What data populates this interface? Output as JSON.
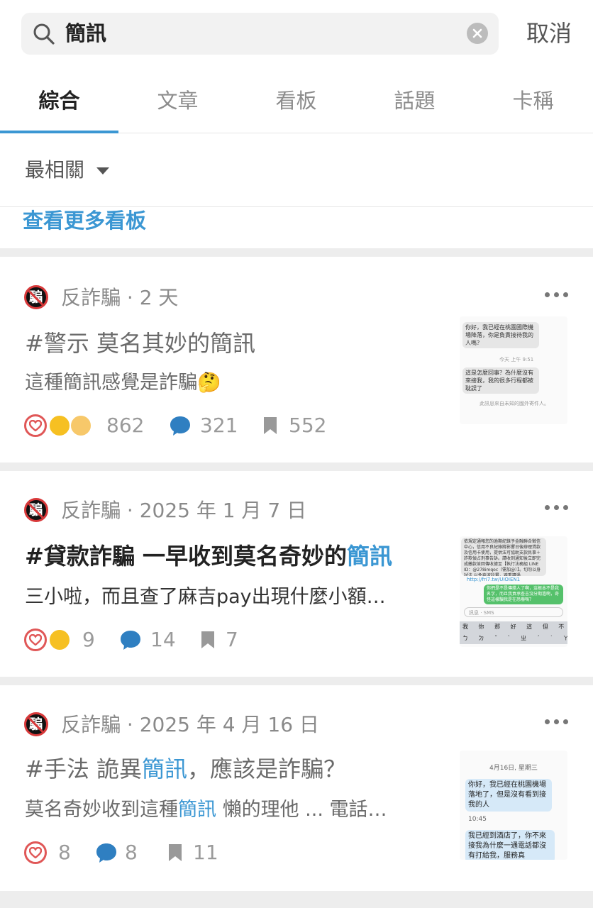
{
  "search": {
    "query": "簡訊",
    "cancel_label": "取消"
  },
  "tabs": [
    {
      "label": "綜合"
    },
    {
      "label": "文章"
    },
    {
      "label": "看板"
    },
    {
      "label": "話題"
    },
    {
      "label": "卡稱"
    }
  ],
  "sort": {
    "label": "最相關"
  },
  "more_boards": {
    "label": "查看更多看板"
  },
  "colors": {
    "accent": "#3b97d3",
    "like": "#e05757",
    "gap": "#ededed"
  },
  "posts": [
    {
      "board": "反詐騙",
      "time": "2 天",
      "title": "#警示 莫名其妙的簡訊",
      "snippet": "這種簡訊感覺是詐騙🤔",
      "likes": "862",
      "comments": "321",
      "bookmarks": "552",
      "thumb": {
        "msg1": "你好，我已經在桃園國際機場降落，你是負責接待我的人嗎？",
        "time": "今天 上午 9:51",
        "msg2": "這是怎麼回事？為什麼沒有來接我，我的很多行程都被耽誤了",
        "note": "此訊息來自未知的國外寄件人。"
      }
    },
    {
      "board": "反詐騙",
      "time": "2025 年 1 月 7 日",
      "title_pre": "#貸款詐騙 一早收到莫名奇妙的",
      "title_hl": "簡訊",
      "snippet": "三小啦，而且查了麻吉pay出現什麼小額…",
      "likes": "9",
      "comments": "14",
      "bookmarks": "7",
      "thumb": {
        "msg1": "依規定通報您的逾期紀錄予金融聯合徵信中心，信用不良紀錄將影響日後辦理貸款及信用卡使用，提供法可協助支款民事＋詐欺偵占刑事告訴。請收到通知後立即完成繳款並回傳收據至【執行法務組 LINE ID：@278imqoc（需加@）】。切勿以身試法 以免奔波訟累，避重讀過",
        "link": "http://fri7.tw/UIOIEN1",
        "msg2": "你們是不是傳錯人了啊，這根本不是我名字，而且我貢承查吉沒分期過啊，奇怪這樣騙我是在恐嚇嗎？",
        "input_placeholder": "訊息 · SMS",
        "kb1": "我 你 那 好 這 但 不 有 哈",
        "kb2": "ㄅ ㄉ ˇ ˋ ㄓ ˊ ˙ ㄚ ㄞ ㄢ"
      }
    },
    {
      "board": "反詐騙",
      "time": "2025 年 4 月 16 日",
      "title_pre": "#手法 詭異",
      "title_hl": "簡訊",
      "title_post": "，應該是詐騙？",
      "snippet_pre": "莫名奇妙收到這種",
      "snippet_hl": "簡訊",
      "snippet_post": " 懶的理他 ... 電話…",
      "likes": "8",
      "comments": "8",
      "bookmarks": "11",
      "thumb": {
        "date": "4月16日, 星期三",
        "msg1": "你好，我已經在桃園機場落地了，但是沒有看到接我的人",
        "time": "10:45",
        "msg2": "我已經到酒店了，你不來接我為什麼一通電話都沒有打給我，服務真"
      }
    }
  ]
}
